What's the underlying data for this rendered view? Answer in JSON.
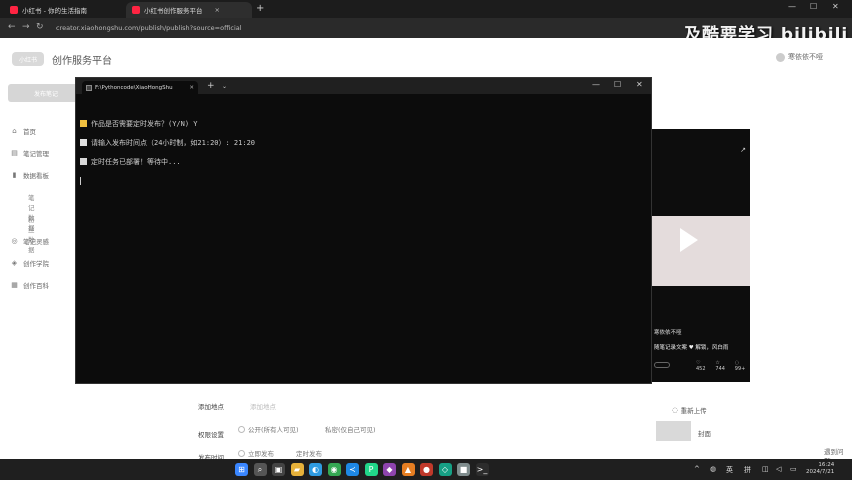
{
  "browser": {
    "tabs": [
      {
        "label": "小红书 - 你的生活指南"
      },
      {
        "label": "小红书创作服务平台"
      }
    ],
    "new_tab": "+",
    "url": "creator.xiaohongshu.com/publish/publish?source=official",
    "watermark": "及酷要学习 bilibili",
    "win_min": "—",
    "win_max": "☐",
    "win_close": "✕",
    "back": "←",
    "forward": "→",
    "reload": "↻"
  },
  "header": {
    "logo": "小红书",
    "brand": "创作服务平台",
    "user_name": "寒依依不哑"
  },
  "sidebar": {
    "publish_button": "发布笔记",
    "items": [
      {
        "icon": "⌂",
        "label": "首页"
      },
      {
        "icon": "▤",
        "label": "笔记管理"
      },
      {
        "icon": "▮",
        "label": "数据看板"
      },
      {
        "label": "笔记数据"
      },
      {
        "label": "粉丝数据"
      },
      {
        "icon": "◎",
        "label": "笔记灵感"
      },
      {
        "icon": "◈",
        "label": "创作学院"
      },
      {
        "icon": "▦",
        "label": "创作百科"
      }
    ]
  },
  "terminal": {
    "tab_title": "F:\\Pythoncode\\XiaoHongShu",
    "tab_close": "✕",
    "plus": "+",
    "dropdown": "⌄",
    "lines": [
      {
        "icon_color": "#f0c040",
        "text": "作品是否需要定时发布？(Y/N) Y"
      },
      {
        "icon_color": "#e0e0e0",
        "text": "请输入发布时间点（24小时制，如21:20）: 21:20"
      },
      {
        "icon_color": "#d8d8d8",
        "text": "定时任务已部署！等待中..."
      }
    ]
  },
  "preview": {
    "author": "寒依依不哑",
    "caption": "随笔记录文案 ♥ 解锁，风白雨",
    "stats": [
      "♡ 452",
      "☆ 744",
      "◌ 99+"
    ],
    "ext_icon": "↗"
  },
  "form": {
    "location_label": "添加地点",
    "location_placeholder": "添加地点",
    "permission_label": "权限设置",
    "public_option": "公开(所有人可见)",
    "private_option": "私密(仅自己可见)",
    "publish_label": "发布时间",
    "now_option": "立即发布",
    "scheduled_option": "定时发布",
    "reupload": "重新上传",
    "cover": "封面",
    "help": "遇到问题"
  },
  "taskbar": {
    "icons": [
      {
        "name": "start-icon",
        "glyph": "⊞",
        "color": "#3a86ff"
      },
      {
        "name": "search-icon",
        "glyph": "⌕",
        "color": "#555"
      },
      {
        "name": "taskview-icon",
        "glyph": "▣",
        "color": "#444"
      },
      {
        "name": "explorer-icon",
        "glyph": "▰",
        "color": "#e6b13a"
      },
      {
        "name": "edge-icon",
        "glyph": "◐",
        "color": "#2f9be0"
      },
      {
        "name": "chrome-icon",
        "glyph": "◉",
        "color": "#34a853"
      },
      {
        "name": "vscode-icon",
        "glyph": "≺",
        "color": "#1e88e5"
      },
      {
        "name": "pycharm-icon",
        "glyph": "P",
        "color": "#21d789"
      },
      {
        "name": "app1-icon",
        "glyph": "◆",
        "color": "#8e44ad"
      },
      {
        "name": "app2-icon",
        "glyph": "▲",
        "color": "#e67e22"
      },
      {
        "name": "app3-icon",
        "glyph": "●",
        "color": "#c0392b"
      },
      {
        "name": "app4-icon",
        "glyph": "◇",
        "color": "#16a085"
      },
      {
        "name": "app5-icon",
        "glyph": "■",
        "color": "#7f8c8d"
      },
      {
        "name": "terminal-icon",
        "glyph": ">_",
        "color": "#2c2c2c"
      }
    ],
    "tray_caret": "^",
    "lang": "英",
    "ime": "拼",
    "time": "16:24",
    "date": "2024/7/21"
  }
}
